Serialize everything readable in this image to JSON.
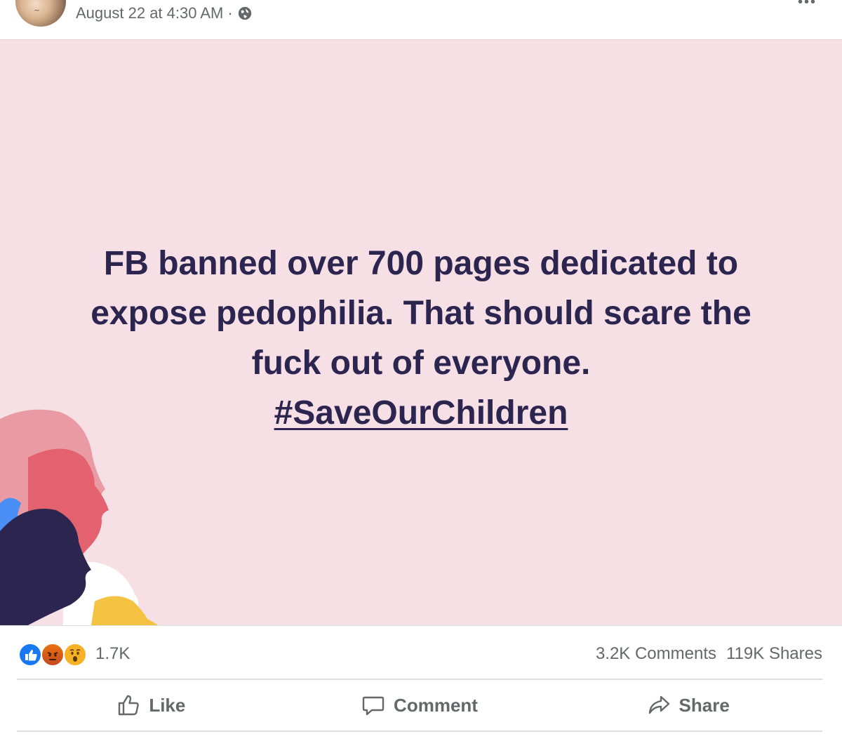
{
  "post": {
    "timestamp": "August 22 at 4:30 AM",
    "separator": "·",
    "privacy_icon": "globe-icon",
    "more_icon": "more-icon",
    "image_text": {
      "line1": "FB banned over 700 pages dedicated to",
      "line2": "expose pedophilia. That should scare the",
      "line3": "fuck out of everyone.",
      "hashtag": "#SaveOurChildren"
    },
    "colors": {
      "image_background": "#f6e0e5",
      "text": "#2b2550",
      "silhouette_pink": "#e4626f",
      "silhouette_light_pink": "#e99aa3",
      "silhouette_navy": "#2b2550",
      "silhouette_blue": "#4a8ff5",
      "silhouette_yellow": "#f5c342"
    }
  },
  "reactions": {
    "icons": [
      "like-icon",
      "angry-icon",
      "wow-icon"
    ],
    "count": "1.7K"
  },
  "engagement": {
    "comments": "3.2K Comments",
    "shares": "119K Shares"
  },
  "actions": {
    "like": "Like",
    "comment": "Comment",
    "share": "Share"
  }
}
